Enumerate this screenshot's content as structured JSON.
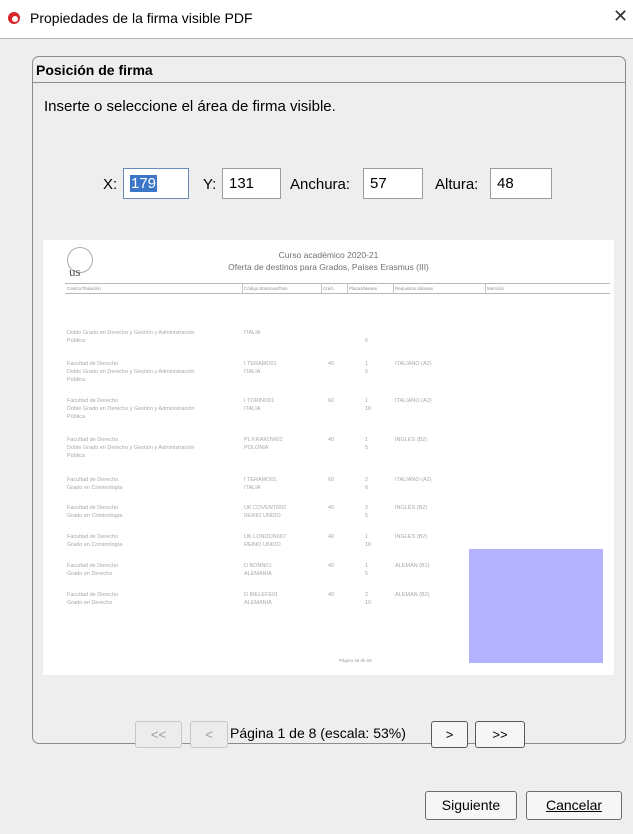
{
  "window": {
    "title": "Propiedades de la firma visible PDF",
    "close_glyph": "✕",
    "icon": "acrobat-icon"
  },
  "panel": {
    "title": "Posición de firma",
    "instruction": "Inserte o seleccione el área de firma visible."
  },
  "fields": {
    "x": {
      "label": "X:",
      "value": "179"
    },
    "y": {
      "label": "Y:",
      "value": "131"
    },
    "width": {
      "label": "Anchura:",
      "value": "57"
    },
    "height": {
      "label": "Altura:",
      "value": "48"
    }
  },
  "preview": {
    "logo_text": "us",
    "title_line1": "Curso académico 2020-21",
    "title_line2": "Oferta de destinos para Grados, Países Erasmus (III)",
    "headers": [
      "Centro/Titulación",
      "Código Erasmus/País",
      "Créd.",
      "Plazas/Meses",
      "Requisitos Idiomas",
      "Mención"
    ],
    "rows": [
      {
        "centro": [
          "Doble Grado en Derecho y Gestión y Administración",
          "Pública"
        ],
        "codigo": [
          "ITALIA"
        ],
        "cred": "",
        "plazas": [
          "",
          "6"
        ],
        "idiomas": ""
      },
      {
        "centro": [
          "Facultad de Derecho",
          "Doble Grado en Derecho y Gestión y Administración",
          "Pública"
        ],
        "codigo": [
          "I TERAMO01",
          "ITALIA"
        ],
        "cred": "40",
        "plazas": [
          "1",
          "6"
        ],
        "idiomas": "ITALIANO (A2)"
      },
      {
        "centro": [
          "Facultad de Derecho",
          "Doble Grado en Derecho y Gestión y Administración",
          "Pública"
        ],
        "codigo": [
          "I TORINO01",
          "ITALIA"
        ],
        "cred": "60",
        "plazas": [
          "1",
          "10"
        ],
        "idiomas": "ITALIANO (A2)"
      },
      {
        "centro": [
          "Facultad de Derecho",
          "Doble Grado en Derecho y Gestión y Administración",
          "Pública"
        ],
        "codigo": [
          "PL KRAKOW01",
          "POLONIA"
        ],
        "cred": "40",
        "plazas": [
          "1",
          "5"
        ],
        "idiomas": "INGLÉS (B2)"
      },
      {
        "centro": [
          "Facultad de Derecho",
          "Grado en Criminología"
        ],
        "codigo": [
          "I TERAMO01",
          "ITALIA"
        ],
        "cred": "60",
        "plazas": [
          "2",
          "6"
        ],
        "idiomas": "ITALIANO (A2)"
      },
      {
        "centro": [
          "Facultad de Derecho",
          "Grado en Criminología"
        ],
        "codigo": [
          "UK COVENTR02",
          "REINO UNIDO"
        ],
        "cred": "40",
        "plazas": [
          "2",
          "5"
        ],
        "idiomas": "INGLÉS (B2)"
      },
      {
        "centro": [
          "Facultad de Derecho",
          "Grado en Criminología"
        ],
        "codigo": [
          "UK LONDON067",
          "REINO UNIDO"
        ],
        "cred": "40",
        "plazas": [
          "1",
          "10"
        ],
        "idiomas": "INGLÉS (B2)"
      },
      {
        "centro": [
          "Facultad de Derecho",
          "Grado en Derecho"
        ],
        "codigo": [
          "D BONN01",
          "ALEMANIA"
        ],
        "cred": "40",
        "plazas": [
          "1",
          "5"
        ],
        "idiomas": "ALEMÁN (B1)"
      },
      {
        "centro": [
          "Facultad de Derecho",
          "Grado en Derecho"
        ],
        "codigo": [
          "D BIELEFE01",
          "ALEMANIA"
        ],
        "cred": "40",
        "plazas": [
          "2",
          "10"
        ],
        "idiomas": "ALEMÁN (B2)"
      }
    ],
    "footer": "Página 48 de 69",
    "signature_color": "#b3b3ff"
  },
  "pager": {
    "first": "<<",
    "prev": "<",
    "label": "Página 1 de 8 (escala: 53%)",
    "next": ">",
    "last": ">>"
  },
  "buttons": {
    "next": "Siguiente",
    "cancel": "Cancelar"
  },
  "colors": {
    "accent": "#3b76c9",
    "window_bg": "#eeeeee",
    "icon_red": "#d8262c"
  }
}
